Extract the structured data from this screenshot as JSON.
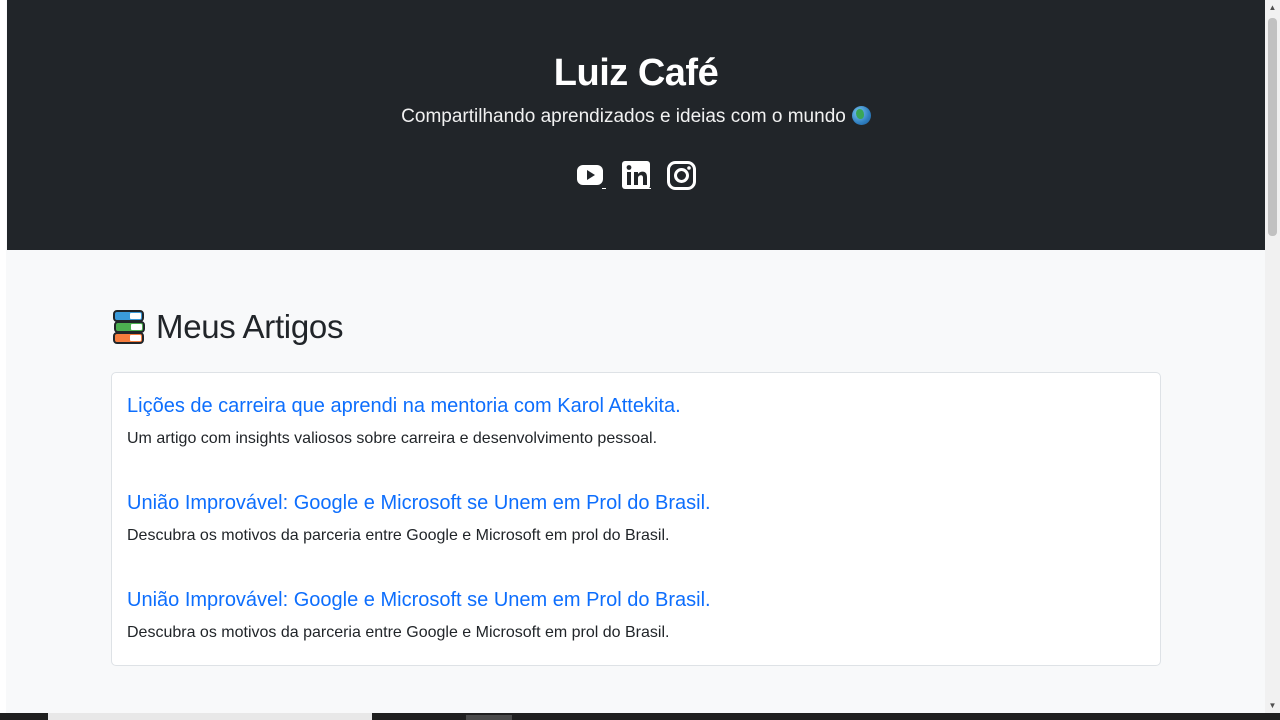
{
  "header": {
    "title": "Luiz Café",
    "subtitle": "Compartilhando aprendizados e ideias com o mundo"
  },
  "socials": [
    {
      "name": "youtube-icon"
    },
    {
      "name": "linkedin-icon"
    },
    {
      "name": "instagram-icon"
    }
  ],
  "section": {
    "title": "Meus Artigos"
  },
  "articles": [
    {
      "title": "Lições de carreira que aprendi na mentoria com Karol Attekita.",
      "description": "Um artigo com insights valiosos sobre carreira e desenvolvimento pessoal."
    },
    {
      "title": "União Improvável: Google e Microsoft se Unem em Prol do Brasil.",
      "description": "Descubra os motivos da parceria entre Google e Microsoft em prol do Brasil."
    },
    {
      "title": "União Improvável: Google e Microsoft se Unem em Prol do Brasil.",
      "description": "Descubra os motivos da parceria entre Google e Microsoft em prol do Brasil."
    }
  ],
  "colors": {
    "header_bg": "#212529",
    "link": "#0d6efd",
    "page_bg": "#f8f9fa"
  }
}
